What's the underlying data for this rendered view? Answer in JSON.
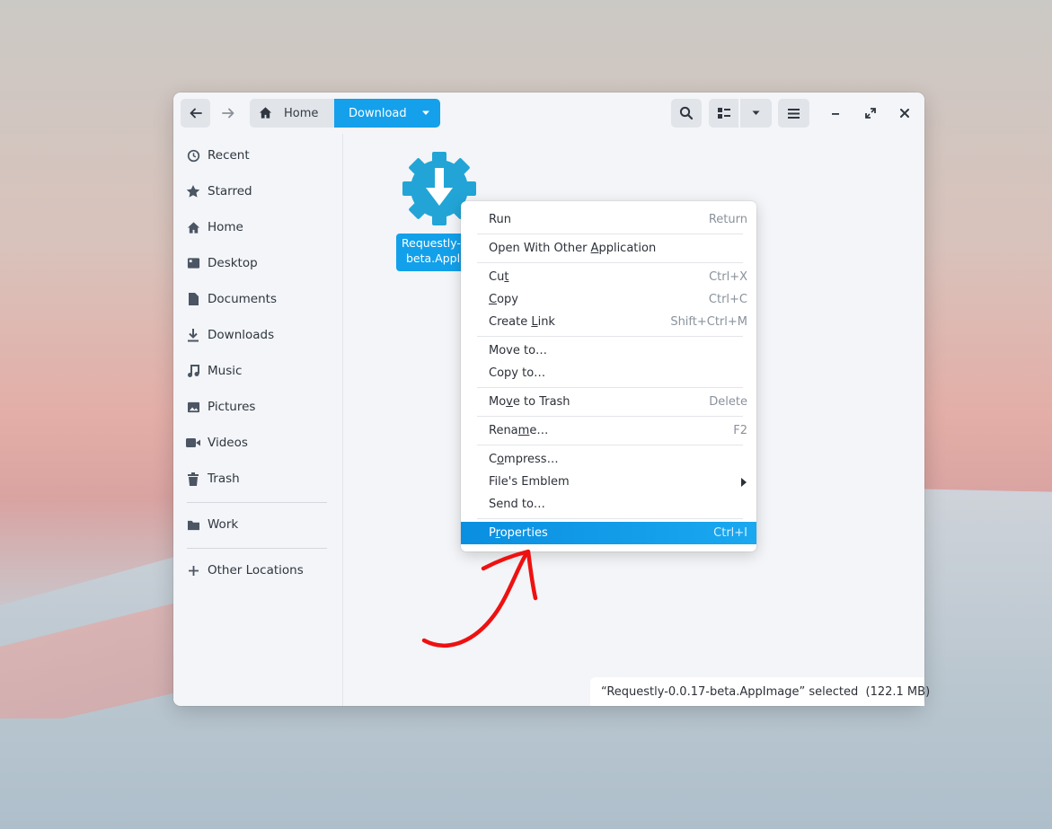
{
  "header": {
    "back_icon": "arrow-left-icon",
    "forward_icon": "arrow-right-icon",
    "breadcrumb": [
      {
        "label": "Home",
        "icon": "home-icon"
      },
      {
        "label": "Download",
        "active": true
      }
    ],
    "search_icon": "search-icon",
    "view_icon": "list-view-icon",
    "view_dropdown_icon": "chevron-down-icon",
    "menu_icon": "hamburger-icon",
    "window_controls": [
      "minimize-icon",
      "maximize-icon",
      "close-icon"
    ]
  },
  "sidebar": {
    "items": [
      {
        "label": "Recent",
        "icon": "clock-icon"
      },
      {
        "label": "Starred",
        "icon": "star-icon"
      },
      {
        "label": "Home",
        "icon": "home-icon"
      },
      {
        "label": "Desktop",
        "icon": "desktop-icon"
      },
      {
        "label": "Documents",
        "icon": "document-icon"
      },
      {
        "label": "Downloads",
        "icon": "download-icon"
      },
      {
        "label": "Music",
        "icon": "music-icon"
      },
      {
        "label": "Pictures",
        "icon": "picture-icon"
      },
      {
        "label": "Videos",
        "icon": "video-icon"
      },
      {
        "label": "Trash",
        "icon": "trash-icon"
      }
    ],
    "bookmarks": [
      {
        "label": "Work",
        "icon": "folder-icon"
      }
    ],
    "other": {
      "label": "Other Locations",
      "icon": "plus-icon"
    }
  },
  "file": {
    "name_line1": "Requestly-",
    "name_line2": "beta.Appl",
    "icon": "appimage-gear-download-icon"
  },
  "context_menu": {
    "groups": [
      [
        {
          "pre": "Run",
          "u": "",
          "post": "",
          "accel": "Return"
        }
      ],
      [
        {
          "pre": "Open With Other ",
          "u": "A",
          "post": "pplication",
          "accel": ""
        }
      ],
      [
        {
          "pre": "Cu",
          "u": "t",
          "post": "",
          "accel": "Ctrl+X"
        },
        {
          "pre": "",
          "u": "C",
          "post": "opy",
          "accel": "Ctrl+C"
        },
        {
          "pre": "Create ",
          "u": "L",
          "post": "ink",
          "accel": "Shift+Ctrl+M"
        }
      ],
      [
        {
          "pre": "Move to…",
          "u": "",
          "post": "",
          "accel": ""
        },
        {
          "pre": "Copy to…",
          "u": "",
          "post": "",
          "accel": ""
        }
      ],
      [
        {
          "pre": "Mo",
          "u": "v",
          "post": "e to Trash",
          "accel": "Delete"
        }
      ],
      [
        {
          "pre": "Rena",
          "u": "m",
          "post": "e…",
          "accel": "F2"
        }
      ],
      [
        {
          "pre": "C",
          "u": "o",
          "post": "mpress…",
          "accel": ""
        },
        {
          "pre": "File's Emblem",
          "u": "",
          "post": "",
          "accel": "",
          "submenu": true
        },
        {
          "pre": "Send to…",
          "u": "",
          "post": "",
          "accel": ""
        }
      ],
      [
        {
          "pre": "P",
          "u": "r",
          "post": "operties",
          "accel": "Ctrl+I",
          "selected": true
        }
      ]
    ]
  },
  "status_bar": {
    "text": "“Requestly-0.0.17-beta.AppImage” selected  (122.1 MB)"
  },
  "colors": {
    "accent": "#0ea0ec",
    "annotation": "#ee1111"
  }
}
